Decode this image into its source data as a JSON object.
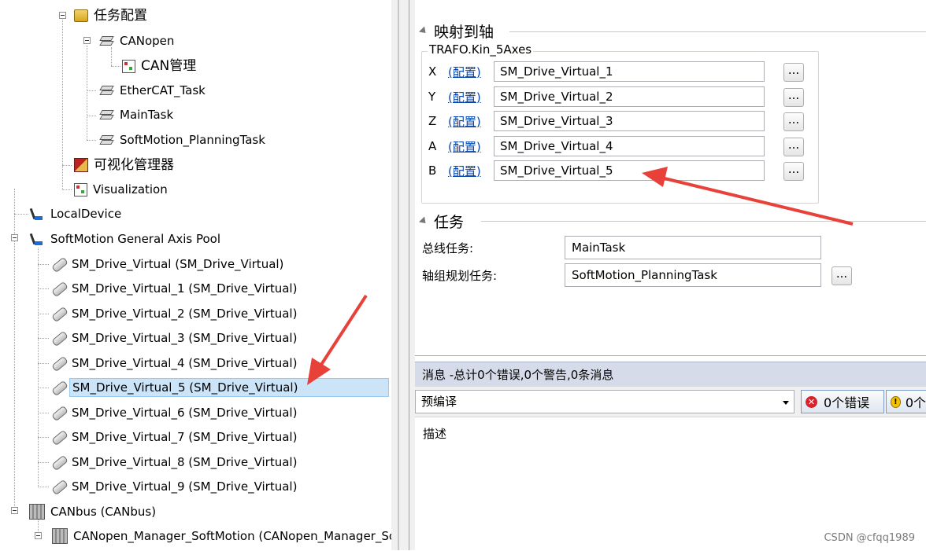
{
  "tree": {
    "task_config": "任务配置",
    "canopen": "CANopen",
    "can_manager": "CAN管理",
    "ethercat_task": "EtherCAT_Task",
    "main_task": "MainTask",
    "softmotion_planning_task": "SoftMotion_PlanningTask",
    "visu_manager": "可视化管理器",
    "visualization": "Visualization",
    "local_device": "LocalDevice",
    "axis_pool": "SoftMotion General Axis Pool",
    "drives": [
      "SM_Drive_Virtual (SM_Drive_Virtual)",
      "SM_Drive_Virtual_1 (SM_Drive_Virtual)",
      "SM_Drive_Virtual_2 (SM_Drive_Virtual)",
      "SM_Drive_Virtual_3 (SM_Drive_Virtual)",
      "SM_Drive_Virtual_4 (SM_Drive_Virtual)",
      "SM_Drive_Virtual_5 (SM_Drive_Virtual)",
      "SM_Drive_Virtual_6 (SM_Drive_Virtual)",
      "SM_Drive_Virtual_7 (SM_Drive_Virtual)",
      "SM_Drive_Virtual_8 (SM_Drive_Virtual)",
      "SM_Drive_Virtual_9 (SM_Drive_Virtual)"
    ],
    "canbus": "CANbus (CANbus)",
    "canopen_manager": "CANopen_Manager_SoftMotion (CANopen_Manager_So"
  },
  "mapping": {
    "header": "映射到轴",
    "group_title": "TRAFO.Kin_5Axes",
    "config_link": "(配置)",
    "dots": "...",
    "axes": [
      {
        "axis": "X",
        "value": "SM_Drive_Virtual_1"
      },
      {
        "axis": "Y",
        "value": "SM_Drive_Virtual_2"
      },
      {
        "axis": "Z",
        "value": "SM_Drive_Virtual_3"
      },
      {
        "axis": "A",
        "value": "SM_Drive_Virtual_4"
      },
      {
        "axis": "B",
        "value": "SM_Drive_Virtual_5"
      }
    ]
  },
  "tasks": {
    "header": "任务",
    "bus_task_label": "总线任务:",
    "bus_task_value": "MainTask",
    "planning_task_label": "轴组规划任务:",
    "planning_task_value": "SoftMotion_PlanningTask",
    "dots": "..."
  },
  "messages": {
    "header": "消息 -总计0个错误,0个警告,0条消息",
    "filter": "预编译",
    "errors_btn": "0个错误",
    "warnings_btn": "0个",
    "description": "描述"
  },
  "watermark": "CSDN @cfqq1989",
  "colors": {
    "arrow": "#e8413a",
    "selection": "#cce4f7",
    "link": "#0645ad",
    "msg_header": "#d6dbe9"
  }
}
